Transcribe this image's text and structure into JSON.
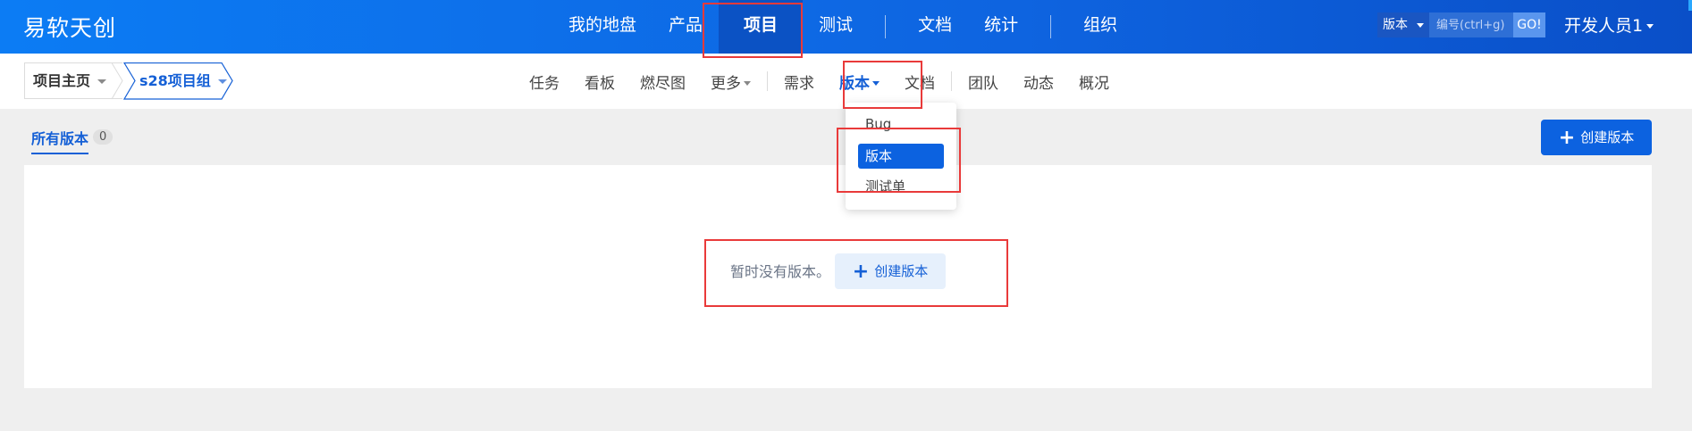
{
  "header": {
    "brand": "易软天创",
    "nav": [
      {
        "label": "我的地盘"
      },
      {
        "label": "产品"
      },
      {
        "label": "项目"
      },
      {
        "label": "测试"
      },
      {
        "label": "文档"
      },
      {
        "label": "统计"
      },
      {
        "label": "组织"
      }
    ],
    "active_nav": "项目",
    "search": {
      "type_label": "版本",
      "placeholder": "编号(ctrl+g)",
      "go_label": "GO!"
    },
    "user": "开发人员1"
  },
  "breadcrumb": {
    "home": "项目主页",
    "project": "s28项目组"
  },
  "subnav": {
    "items": [
      "任务",
      "看板",
      "燃尽图",
      "更多",
      "需求",
      "版本",
      "文档",
      "团队",
      "动态",
      "概况"
    ],
    "active": "版本"
  },
  "dropdown": {
    "items": [
      "Bug",
      "版本",
      "测试单"
    ],
    "selected": "版本"
  },
  "toolbar": {
    "tab_label": "所有版本",
    "tab_count": "0",
    "create_label": "创建版本"
  },
  "main": {
    "empty_text": "暂时没有版本。",
    "create_label": "创建版本"
  },
  "colors": {
    "header_blue": "#0e64e0",
    "accent": "#0c62e0",
    "highlight": "#e93a3a"
  }
}
